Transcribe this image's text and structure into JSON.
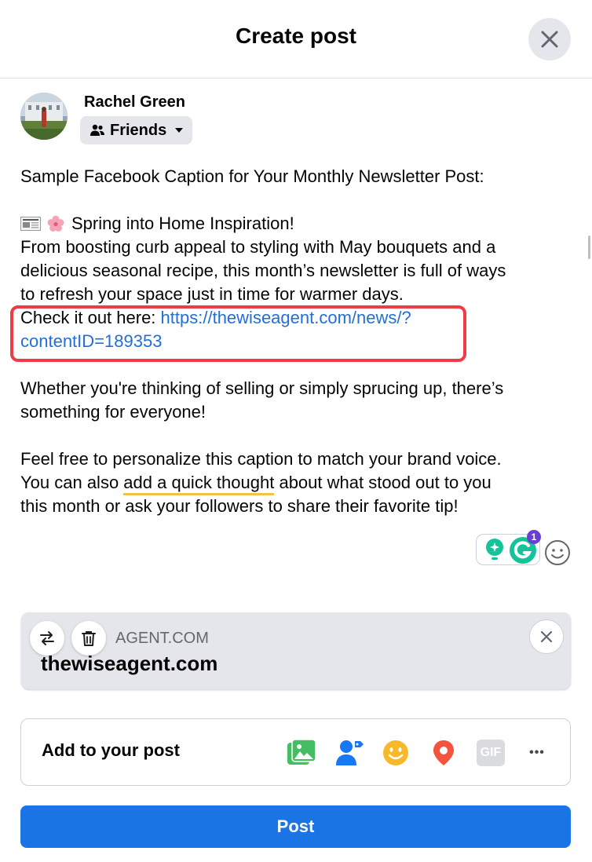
{
  "header": {
    "title": "Create post"
  },
  "user": {
    "name": "Rachel Green",
    "audience": "Friends"
  },
  "post_text": {
    "intro": "Sample Facebook Caption for Your Monthly Newsletter Post:",
    "headline": "Spring into Home Inspiration!",
    "body_line1": "From boosting curb appeal to styling with May bouquets and a",
    "body_line2": "delicious seasonal recipe, this month’s newsletter is full of ways",
    "body_line3": "to refresh your space just in time for warmer days.",
    "check_prefix": "Check it out here: ",
    "link_line1": "https://thewiseagent.com/news/?",
    "link_line2": "contentID=189353",
    "para2_line1": "Whether you're thinking of selling or simply sprucing up, there’s",
    "para2_line2": "something for everyone!",
    "para3_line1": "Feel free to personalize this caption to match your brand voice.",
    "para3_line2_a": "You can also ",
    "para3_line2_b": "add a quick thought",
    "para3_line2_c": " about what stood out to you",
    "para3_line3": "this month or ask your followers to share their favorite tip!"
  },
  "grammarly": {
    "badge_count": "1"
  },
  "link_preview": {
    "domain": "AGENT.COM",
    "title": "thewiseagent.com"
  },
  "add_to_post": {
    "label": "Add to your post",
    "tools": [
      "photo-video-icon",
      "tag-people-icon",
      "feeling-icon",
      "check-in-icon",
      "gif-icon",
      "more-icon"
    ],
    "gif_label": "GIF",
    "more_label": "•••"
  },
  "post_button": {
    "label": "Post"
  },
  "colors": {
    "accent": "#1b74e4",
    "link": "#216fdb",
    "highlight": "#ef3b43"
  }
}
